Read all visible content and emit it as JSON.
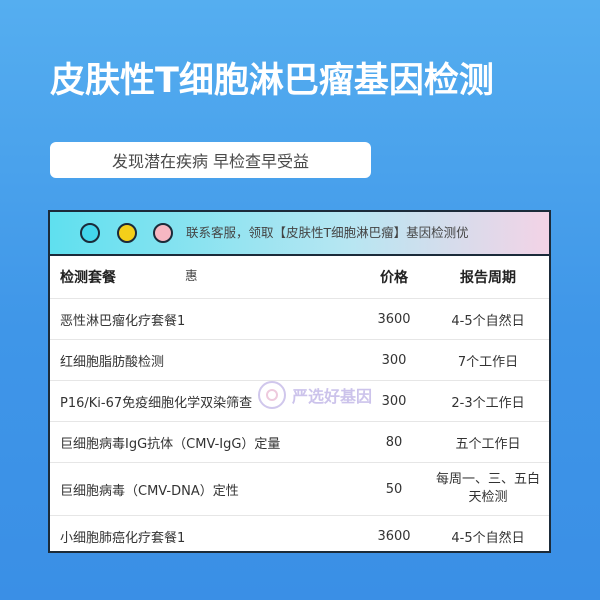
{
  "title": "皮肤性T细胞淋巴瘤基因检测",
  "subtitle": "发现潜在疾病 早检查早受益",
  "card": {
    "bar_text": "联系客服，领取【皮肤性T细胞淋巴瘤】基因检测优",
    "bar_text_overflow": "惠"
  },
  "table": {
    "headers": {
      "name": "检测套餐",
      "price": "价格",
      "period": "报告周期"
    },
    "rows": [
      {
        "name": "恶性淋巴瘤化疗套餐1",
        "price": "3600",
        "period": "4-5个自然日"
      },
      {
        "name": "红细胞脂肪酸检测",
        "price": "300",
        "period": "7个工作日"
      },
      {
        "name": "P16/Ki-67免疫细胞化学双染筛查",
        "price": "300",
        "period": "2-3个工作日"
      },
      {
        "name": "巨细胞病毒IgG抗体（CMV-IgG）定量",
        "price": "80",
        "period": "五个工作日"
      },
      {
        "name": "巨细胞病毒（CMV-DNA）定性",
        "price": "50",
        "period_line1": "每周一、三、五白",
        "period_line2": "天检测"
      },
      {
        "name": "小细胞肺癌化疗套餐1",
        "price": "3600",
        "period": "4-5个自然日"
      }
    ]
  },
  "watermark": {
    "text": "严选好基因",
    "icon": "logo-rings-icon"
  }
}
